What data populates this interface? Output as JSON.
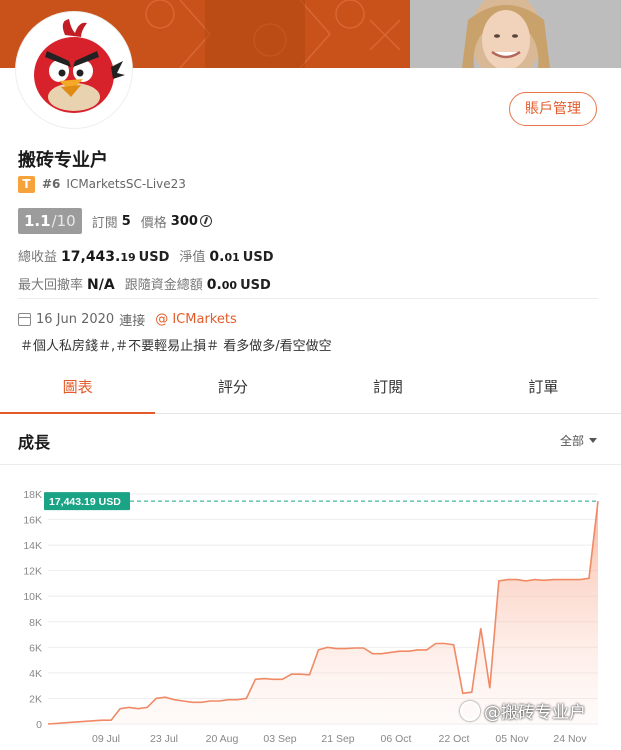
{
  "profile": {
    "name": "搬砖专业户",
    "level_badge": "T",
    "rank": "#6",
    "account_id": "ICMarketsSC-Live23",
    "manage_button": "賬戶管理"
  },
  "rating": {
    "score": "1.1",
    "max": "/10",
    "subscribe_label": "訂閱",
    "subscribe_count": "5",
    "price_label": "價格",
    "price_value": "300",
    "price_icon": "coin-icon"
  },
  "stats": {
    "total_profit_label": "總收益",
    "total_profit_int": "17,443.",
    "total_profit_dec": "19",
    "total_profit_unit": "USD",
    "net_label": "淨值",
    "net_int": "0.",
    "net_dec": "01",
    "net_unit": "USD",
    "drawdown_label": "最大回撤率",
    "drawdown_value": "N/A",
    "follow_label": "跟隨資金總額",
    "follow_int": "0.",
    "follow_dec": "00",
    "follow_unit": "USD"
  },
  "connection": {
    "date": "16 Jun 2020",
    "connect_label": "連接",
    "broker": "@ ICMarkets"
  },
  "tags": "＃個人私房錢＃,＃不要輕易止損＃ 看多做多/看空做空",
  "tabs": [
    {
      "label": "圖表",
      "active": true
    },
    {
      "label": "評分",
      "active": false
    },
    {
      "label": "訂閱",
      "active": false
    },
    {
      "label": "訂單",
      "active": false
    }
  ],
  "section": {
    "title": "成長",
    "range": "全部"
  },
  "colors": {
    "accent": "#e35b2a",
    "line": "#f08a66",
    "marker": "#1aa385"
  },
  "chart_data": {
    "type": "area",
    "current_label": "17,443.19 USD",
    "current_value": 17443.19,
    "ylim": [
      0,
      18000
    ],
    "yticks": [
      0,
      2000,
      4000,
      6000,
      8000,
      10000,
      12000,
      14000,
      16000,
      18000
    ],
    "ytick_labels": [
      "0",
      "2K",
      "4K",
      "6K",
      "8K",
      "10K",
      "12K",
      "14K",
      "16K",
      "18K"
    ],
    "xtick_labels": [
      "09 Jul",
      "23 Jul",
      "20 Aug",
      "03 Sep",
      "21 Sep",
      "06 Oct",
      "22 Oct",
      "05 Nov",
      "24 Nov"
    ],
    "grid": true,
    "series": [
      {
        "values": [
          0,
          50,
          100,
          150,
          200,
          250,
          300,
          300,
          1200,
          1300,
          1200,
          1300,
          2000,
          2100,
          1900,
          1800,
          1700,
          1700,
          1800,
          1800,
          1900,
          1900,
          2000,
          3500,
          3550,
          3500,
          3500,
          3900,
          3900,
          3850,
          5800,
          6000,
          5900,
          5900,
          5950,
          5950,
          5500,
          5500,
          5600,
          5700,
          5700,
          5800,
          5800,
          6300,
          6300,
          6200,
          2400,
          2500,
          7500,
          2800,
          11200,
          11300,
          11300,
          11200,
          11300,
          11250,
          11300,
          11300,
          11300,
          11300,
          11400,
          17443.19
        ]
      }
    ]
  },
  "watermark": "@搬砖专业户"
}
